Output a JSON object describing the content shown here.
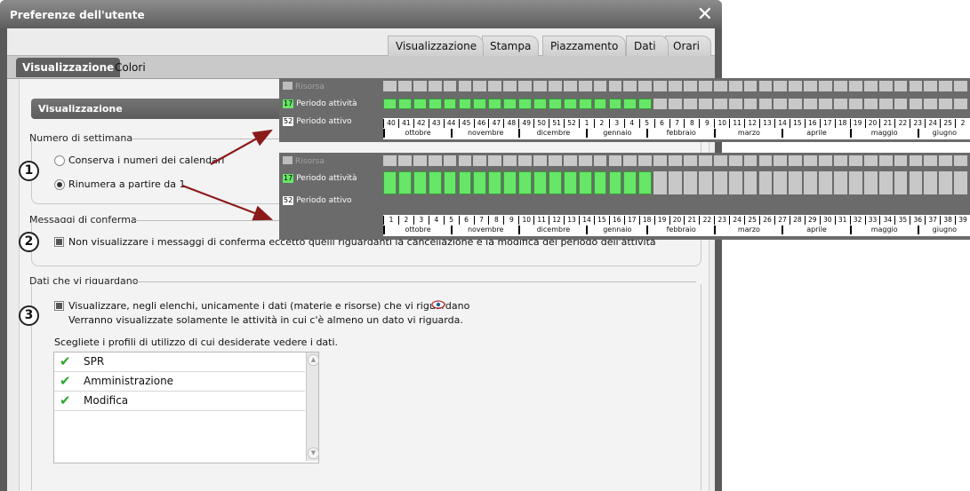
{
  "window": {
    "title": "Preferenze dell'utente"
  },
  "top_tabs": [
    "Visualizzazione",
    "Stampa",
    "Piazzamento",
    "Dati",
    "Orari"
  ],
  "sub_tabs": [
    "Visualizzazione",
    "Colori"
  ],
  "section_title": "Visualizzazione",
  "week_number": {
    "legend": "Numero di settimana",
    "option1": "Conserva i numeri dei calendari",
    "option2": "Rinumera a partire da 1",
    "selected": "option2"
  },
  "confirm_messages": {
    "legend": "Messaggi di conferma",
    "checkbox_label": "Non visualizzare i messaggi di conferma eccetto quelli riguardanti la cancellazione e la modifica del periodo dell'attività"
  },
  "data_concern": {
    "legend": "Dati che vi riguardano",
    "checkbox_label": "Visualizzare, negli elenchi, unicamente i dati (materie e risorse) che vi riguardano",
    "note": "Verranno visualizzate solamente le attività in cui c'è almeno un dato vi riguarda.",
    "profiles_label": "Scegliete i profili di utilizzo di cui desiderate vedere i dati.",
    "profiles": [
      "SPR",
      "Amministrazione",
      "Modifica"
    ]
  },
  "callouts": [
    "1",
    "2",
    "3"
  ],
  "preview1": {
    "row_resource": "Risorsa",
    "row_activity_badge": "17",
    "row_activity": "Periodo attività",
    "row_active_badge": "52",
    "row_active": "Periodo attivo",
    "green_cells": 18,
    "weeks": [
      "40",
      "41",
      "42",
      "43",
      "44",
      "45",
      "46",
      "47",
      "48",
      "49",
      "50",
      "51",
      "52",
      "1",
      "2",
      "3",
      "4",
      "5",
      "6",
      "7",
      "8",
      "9",
      "10",
      "11",
      "12",
      "13",
      "14",
      "15",
      "16",
      "17",
      "18",
      "19",
      "20",
      "21",
      "22",
      "23",
      "24",
      "25",
      "2"
    ],
    "months": [
      "ottobre",
      "novembre",
      "dicembre",
      "gennaio",
      "febbraio",
      "marzo",
      "aprile",
      "maggio",
      "giugno"
    ]
  },
  "preview2": {
    "row_resource": "Risorsa",
    "row_activity_badge": "17",
    "row_activity": "Periodo attività",
    "row_active_badge": "52",
    "row_active": "Periodo attivo",
    "green_cells": 18,
    "weeks": [
      "1",
      "2",
      "3",
      "4",
      "5",
      "6",
      "7",
      "8",
      "9",
      "10",
      "11",
      "12",
      "13",
      "14",
      "15",
      "16",
      "17",
      "18",
      "19",
      "20",
      "21",
      "22",
      "23",
      "24",
      "25",
      "26",
      "27",
      "28",
      "29",
      "30",
      "31",
      "32",
      "33",
      "34",
      "35",
      "36",
      "37",
      "38",
      "39"
    ],
    "months": [
      "ottobre",
      "novembre",
      "dicembre",
      "gennaio",
      "febbraio",
      "marzo",
      "aprile",
      "maggio",
      "giugno"
    ]
  },
  "colors": {
    "green": "#67e667",
    "arrow": "#8b1a1a",
    "titlebar": "#6e6e6e",
    "check": "#2ca82c"
  },
  "icons": {
    "close": "close-icon",
    "eye": "eye-icon",
    "check": "checkmark-icon"
  }
}
